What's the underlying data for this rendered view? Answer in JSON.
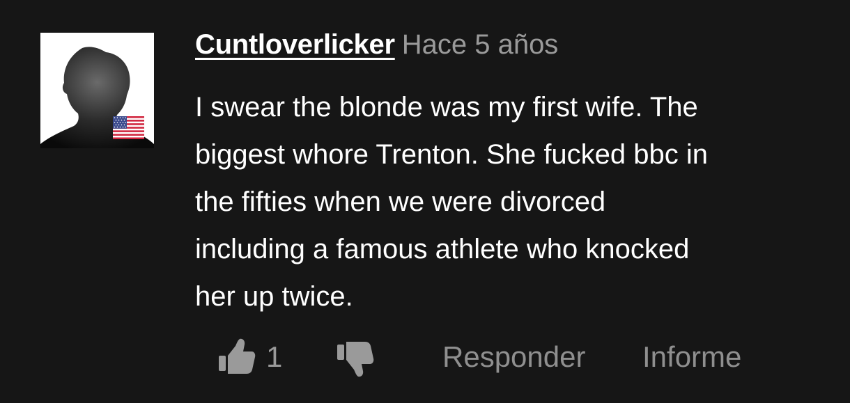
{
  "comment": {
    "username": "Cuntloverlicker",
    "timestamp": "Hace 5 años",
    "avatar_icon": "silhouette-avatar-icon",
    "flag_icon": "us-flag-icon",
    "text_lines": [
      "I swear the blonde was my first wife. The",
      "biggest whore Trenton. She fucked bbc in",
      "the fifties when we were divorced",
      "including a famous athlete who knocked",
      "her up twice."
    ]
  },
  "actions": {
    "like_icon": "thumbs-up-icon",
    "like_count": "1",
    "dislike_icon": "thumbs-down-icon",
    "reply_label": "Responder",
    "report_label": "Informe"
  },
  "colors": {
    "background": "#161616",
    "text": "#ffffff",
    "muted": "#9a9a9a"
  }
}
